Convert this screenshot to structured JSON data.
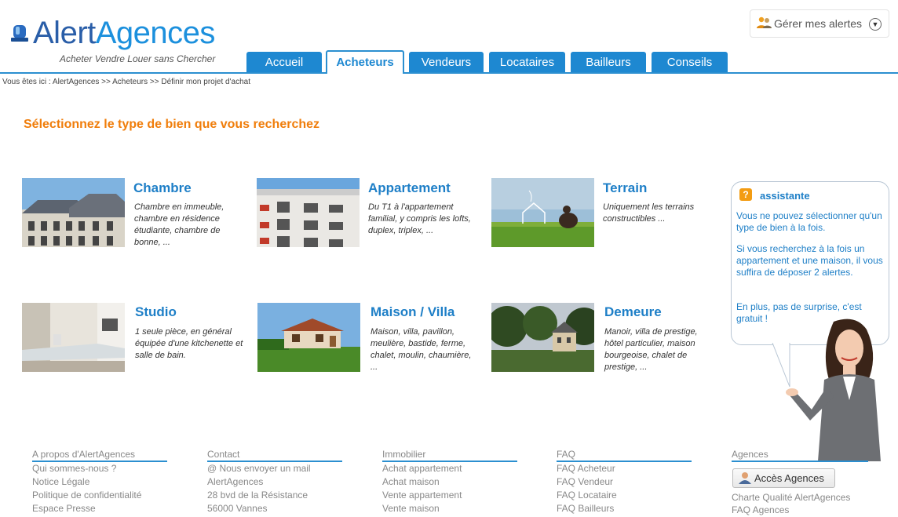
{
  "brand": {
    "name_a": "Alert",
    "name_b": "Agences",
    "tagline": "Acheter Vendre Louer sans Chercher"
  },
  "alerts": {
    "label": "Gérer mes alertes"
  },
  "tabs": [
    "Accueil",
    "Acheteurs",
    "Vendeurs",
    "Locataires",
    "Bailleurs",
    "Conseils"
  ],
  "breadcrumb": "Vous êtes ici : AlertAgences >> Acheteurs >> Définir mon projet d'achat",
  "heading": "Sélectionnez le type de bien que vous recherchez",
  "properties": [
    {
      "title": "Chambre",
      "desc": "Chambre en immeuble, chambre en résidence étudiante, chambre de bonne, ..."
    },
    {
      "title": "Appartement",
      "desc": "Du T1 à l'appartement familial, y compris les lofts, duplex, triplex, ..."
    },
    {
      "title": "Terrain",
      "desc": "Uniquement les terrains constructibles ..."
    },
    {
      "title": "Studio",
      "desc": "1 seule pièce, en général équipée d'une kitchenette et salle de bain."
    },
    {
      "title": "Maison / Villa",
      "desc": "Maison, villa, pavillon, meulière, bastide, ferme, chalet, moulin, chaumière, ..."
    },
    {
      "title": "Demeure",
      "desc": "Manoir, villa de prestige, hôtel particulier, maison bourgeoise, chalet de prestige, ..."
    }
  ],
  "assistant": {
    "title": "assistante",
    "p1": "Vous ne pouvez sélectionner qu'un type de bien à la fois.",
    "p2": "Si vous recherchez à la fois un appartement et une maison, il vous suffira de déposer 2 alertes.",
    "p3": "En plus, pas de surprise, c'est gratuit !"
  },
  "footer": {
    "col1": {
      "head": "A propos d'AlertAgences",
      "items": [
        "Qui sommes-nous ?",
        "Notice Légale",
        "Politique de confidentialité",
        "Espace Presse"
      ]
    },
    "col2": {
      "head": "Contact",
      "items": [
        "@ Nous envoyer un mail",
        "AlertAgences",
        "28 bvd de la Résistance",
        "56000 Vannes"
      ]
    },
    "col3": {
      "head": "Immobilier",
      "items": [
        "Achat appartement",
        "Achat maison",
        "Vente appartement",
        "Vente maison"
      ]
    },
    "col4": {
      "head": "FAQ",
      "items": [
        "FAQ Acheteur",
        "FAQ Vendeur",
        "FAQ Locataire",
        "FAQ Bailleurs"
      ]
    },
    "col5": {
      "head": "Agences",
      "button": "Accès Agences",
      "items": [
        "Charte Qualité AlertAgences",
        "FAQ Agences"
      ]
    }
  }
}
